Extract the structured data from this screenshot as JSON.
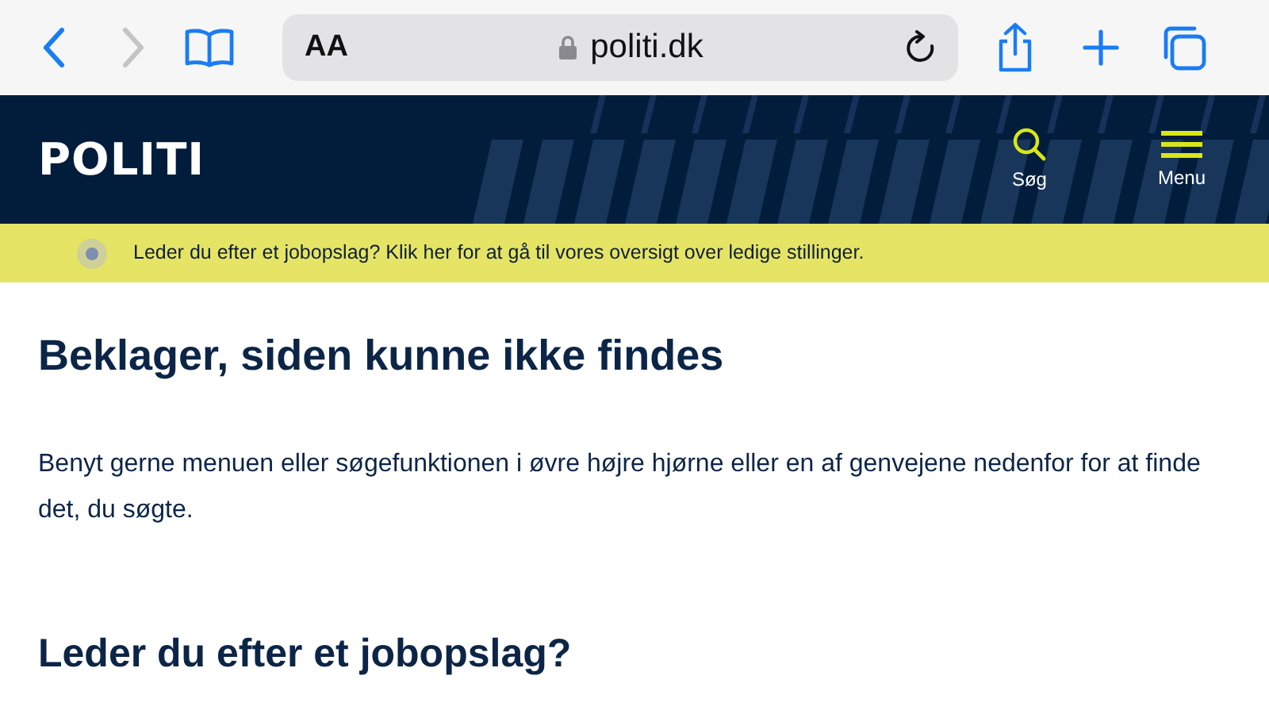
{
  "browser": {
    "text_size": "AA",
    "url": "politi.dk"
  },
  "header": {
    "logo": "POLITI",
    "search_label": "Søg",
    "menu_label": "Menu"
  },
  "banner": {
    "text": "Leder du efter et jobopslag? Klik her for at gå til vores oversigt over ledige stillinger."
  },
  "main": {
    "title": "Beklager, siden kunne ikke findes",
    "body": "Benyt gerne menuen eller søgefunktionen i øvre højre hjørne eller en af genvejene nedenfor for at finde det, du søgte.",
    "section_title": "Leder du efter et jobopslag?"
  }
}
